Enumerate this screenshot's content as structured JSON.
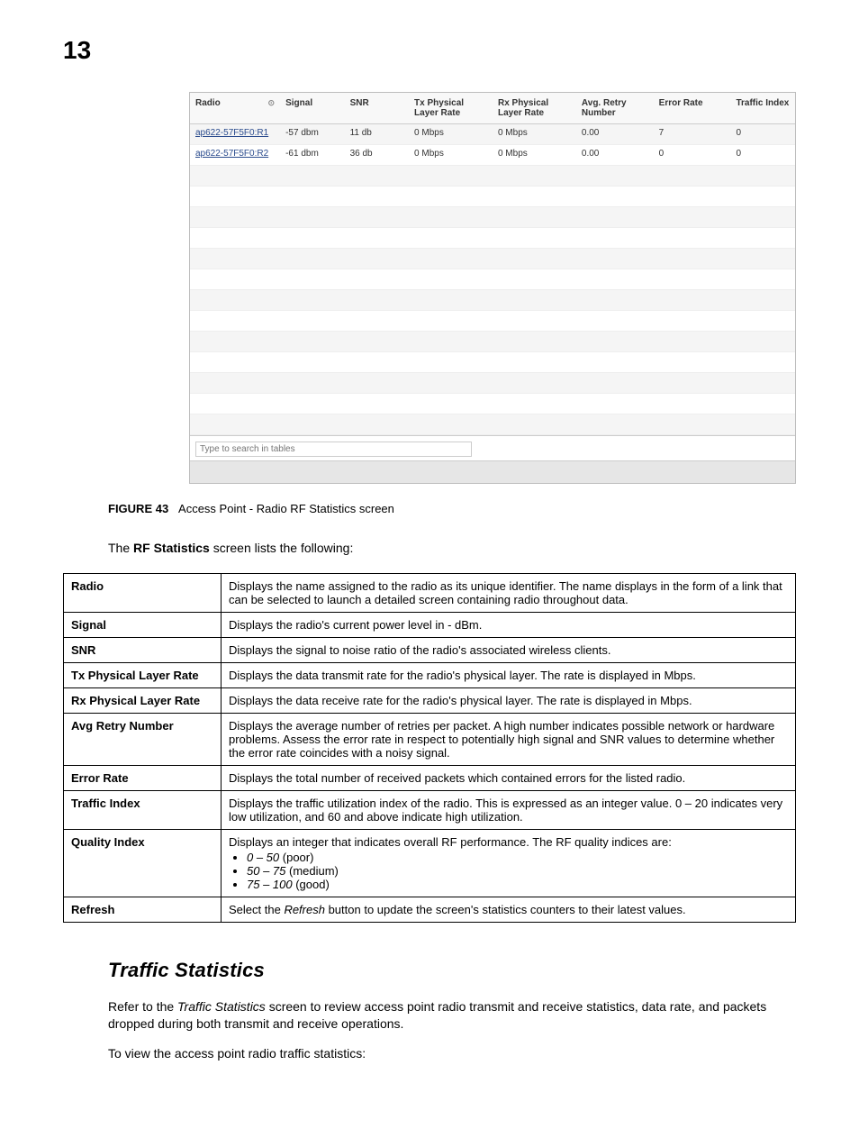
{
  "pageNumber": "13",
  "statsGrid": {
    "headers": [
      "Radio",
      "Signal",
      "SNR",
      "Tx Physical Layer Rate",
      "Rx Physical Layer Rate",
      "Avg. Retry Number",
      "Error Rate",
      "Traffic Index"
    ],
    "rows": [
      {
        "radio": "ap622-57F5F0:R1",
        "signal": "-57 dbm",
        "snr": "11 db",
        "tx": "0 Mbps",
        "rx": "0 Mbps",
        "retry": "0.00",
        "err": "7",
        "traffic": "0"
      },
      {
        "radio": "ap622-57F5F0:R2",
        "signal": "-61 dbm",
        "snr": "36 db",
        "tx": "0 Mbps",
        "rx": "0 Mbps",
        "retry": "0.00",
        "err": "0",
        "traffic": "0"
      }
    ],
    "emptyRowCount": 13,
    "searchPlaceholder": "Type to search in tables"
  },
  "figureCaption": {
    "label": "FIGURE 43",
    "text": "Access Point - Radio RF Statistics screen"
  },
  "introLine": {
    "prefix": "The ",
    "bold": "RF Statistics",
    "suffix": " screen lists the following:"
  },
  "definitions": [
    {
      "term": "Radio",
      "desc": "Displays the name assigned to the radio as its unique identifier. The name displays in the form of a link that can be selected to launch a detailed screen containing radio throughout data."
    },
    {
      "term": "Signal",
      "desc": "Displays the radio's current power level in - dBm."
    },
    {
      "term": "SNR",
      "desc": "Displays the signal to noise ratio of the radio's associated wireless clients."
    },
    {
      "term": "Tx Physical Layer Rate",
      "desc": "Displays the data transmit rate for the radio's physical layer. The rate is displayed in Mbps."
    },
    {
      "term": "Rx Physical Layer Rate",
      "desc": "Displays the data receive rate for the radio's physical layer. The rate is displayed in Mbps."
    },
    {
      "term": "Avg Retry Number",
      "desc": "Displays the average number of retries per packet. A high number indicates possible network or hardware problems. Assess the error rate in respect to potentially high signal and SNR values to determine whether the error rate coincides with a noisy signal."
    },
    {
      "term": "Error Rate",
      "desc": "Displays the total number of received packets which contained errors for the listed radio."
    },
    {
      "term": "Traffic Index",
      "desc": "Displays the traffic utilization index of the radio. This is expressed as an integer value. 0 – 20 indicates very low utilization, and 60 and above indicate high utilization."
    },
    {
      "term": "Quality Index",
      "desc": "Displays an integer that indicates overall RF performance. The RF quality indices are:",
      "bullets": [
        {
          "range": "0 – 50",
          "label": " (poor)"
        },
        {
          "range": "50 – 75",
          "label": " (medium)"
        },
        {
          "range": "75 – 100",
          "label": " (good)"
        }
      ]
    },
    {
      "term": "Refresh",
      "descPrefix": "Select the ",
      "descItalic": "Refresh",
      "descSuffix": " button to update the screen's statistics counters to their latest values."
    }
  ],
  "sectionHeading": "Traffic Statistics",
  "para1": {
    "prefix": "Refer to the ",
    "ital": "Traffic Statistics",
    "suffix": " screen to review access point radio transmit and receive statistics, data rate, and packets dropped during both transmit and receive operations."
  },
  "para2": "To view the access point radio traffic statistics:"
}
